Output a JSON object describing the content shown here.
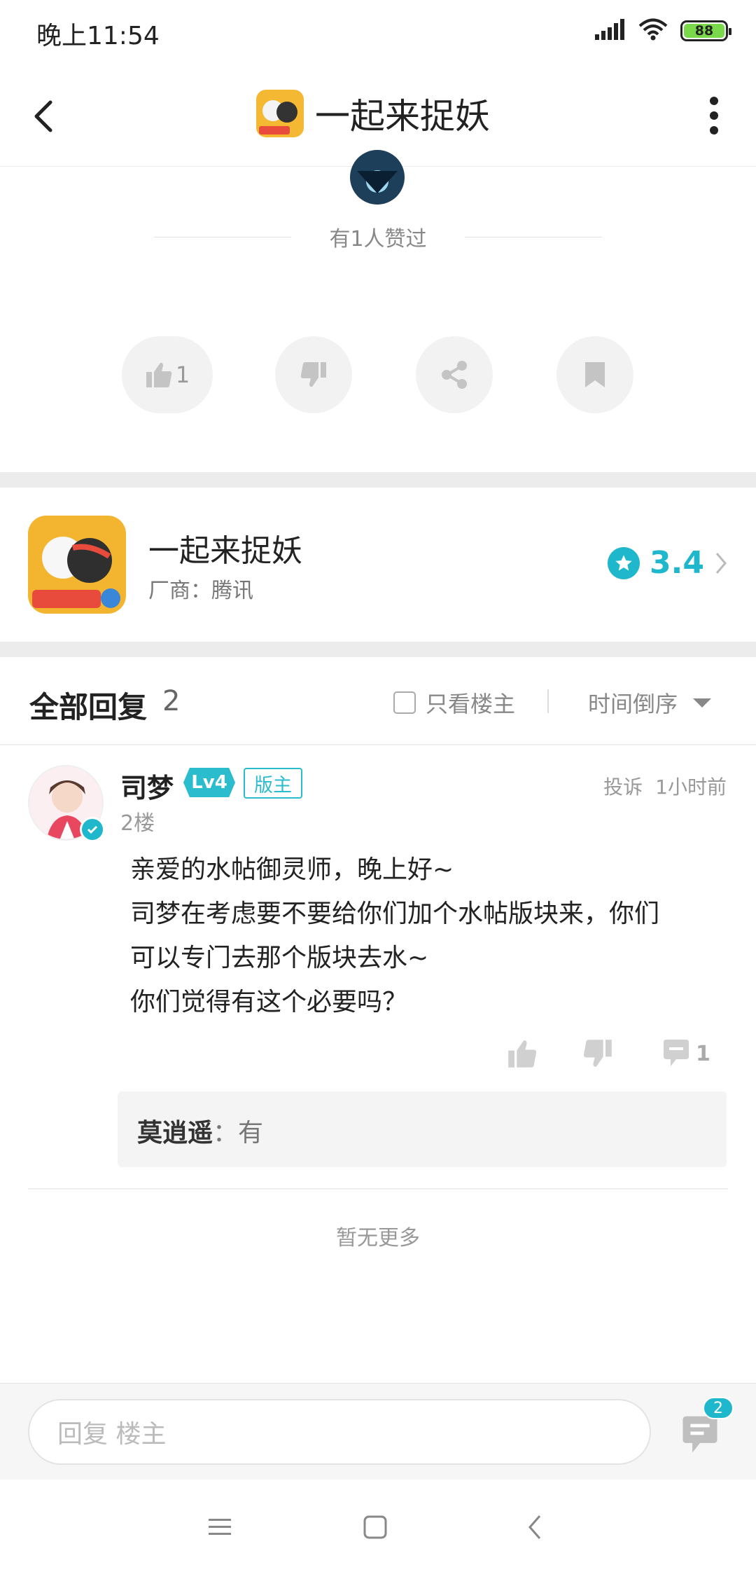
{
  "status_bar": {
    "time": "晚上11:54",
    "battery": "88"
  },
  "header": {
    "title": "一起来捉妖"
  },
  "likes": {
    "liked_text": "有1人赞过",
    "like_count": "1"
  },
  "game": {
    "name": "一起来捉妖",
    "vendor": "厂商：腾讯",
    "rating": "3.4"
  },
  "replies": {
    "title": "全部回复",
    "count": "2",
    "only_host": "只看楼主",
    "sort": "时间倒序"
  },
  "reply": {
    "user": "司梦",
    "level": "Lv4",
    "role": "版主",
    "report": "投诉",
    "time": "1小时前",
    "floor": "2楼",
    "lines": [
      "亲爱的水帖御灵师，晚上好~",
      "司梦在考虑要不要给你们加个水帖版块来，你们",
      "可以专门去那个版块去水~",
      "你们觉得有这个必要吗？"
    ],
    "comment_count": "1",
    "sub_reply": {
      "author": "莫逍遥",
      "sep": "：",
      "text": "有"
    }
  },
  "no_more": "暂无更多",
  "reply_bar": {
    "placeholder": "回复  楼主",
    "badge": "2"
  },
  "colors": {
    "accent": "#1fb7cc"
  }
}
